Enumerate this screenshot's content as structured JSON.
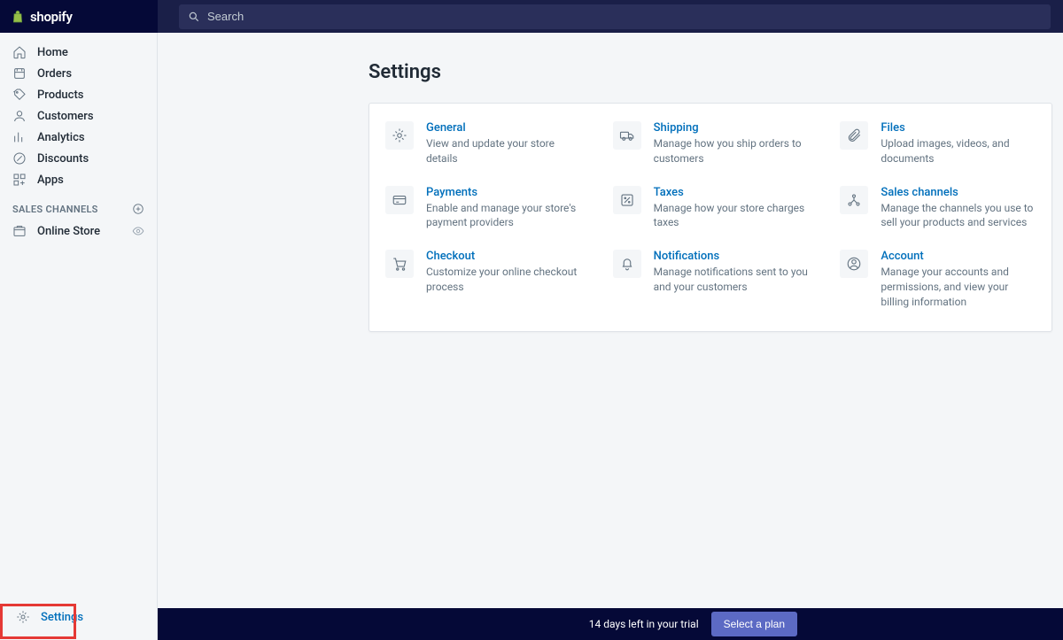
{
  "brand": "shopify",
  "search": {
    "placeholder": "Search"
  },
  "sidebar": {
    "items": [
      {
        "label": "Home"
      },
      {
        "label": "Orders"
      },
      {
        "label": "Products"
      },
      {
        "label": "Customers"
      },
      {
        "label": "Analytics"
      },
      {
        "label": "Discounts"
      },
      {
        "label": "Apps"
      }
    ],
    "channels_header": "SALES CHANNELS",
    "channels": [
      {
        "label": "Online Store"
      }
    ],
    "settings_label": "Settings"
  },
  "page": {
    "title": "Settings",
    "tiles": [
      {
        "title": "General",
        "desc": "View and update your store details",
        "icon": "gear"
      },
      {
        "title": "Shipping",
        "desc": "Manage how you ship orders to customers",
        "icon": "truck"
      },
      {
        "title": "Files",
        "desc": "Upload images, videos, and documents",
        "icon": "clip"
      },
      {
        "title": "Payments",
        "desc": "Enable and manage your store's payment providers",
        "icon": "card"
      },
      {
        "title": "Taxes",
        "desc": "Manage how your store charges taxes",
        "icon": "percent"
      },
      {
        "title": "Sales channels",
        "desc": "Manage the channels you use to sell your products and services",
        "icon": "channels"
      },
      {
        "title": "Checkout",
        "desc": "Customize your online checkout process",
        "icon": "cart"
      },
      {
        "title": "Notifications",
        "desc": "Manage notifications sent to you and your customers",
        "icon": "bell"
      },
      {
        "title": "Account",
        "desc": "Manage your accounts and permissions, and view your billing information",
        "icon": "user"
      }
    ]
  },
  "footer": {
    "trial_text": "14 days left in your trial",
    "button_label": "Select a plan"
  }
}
